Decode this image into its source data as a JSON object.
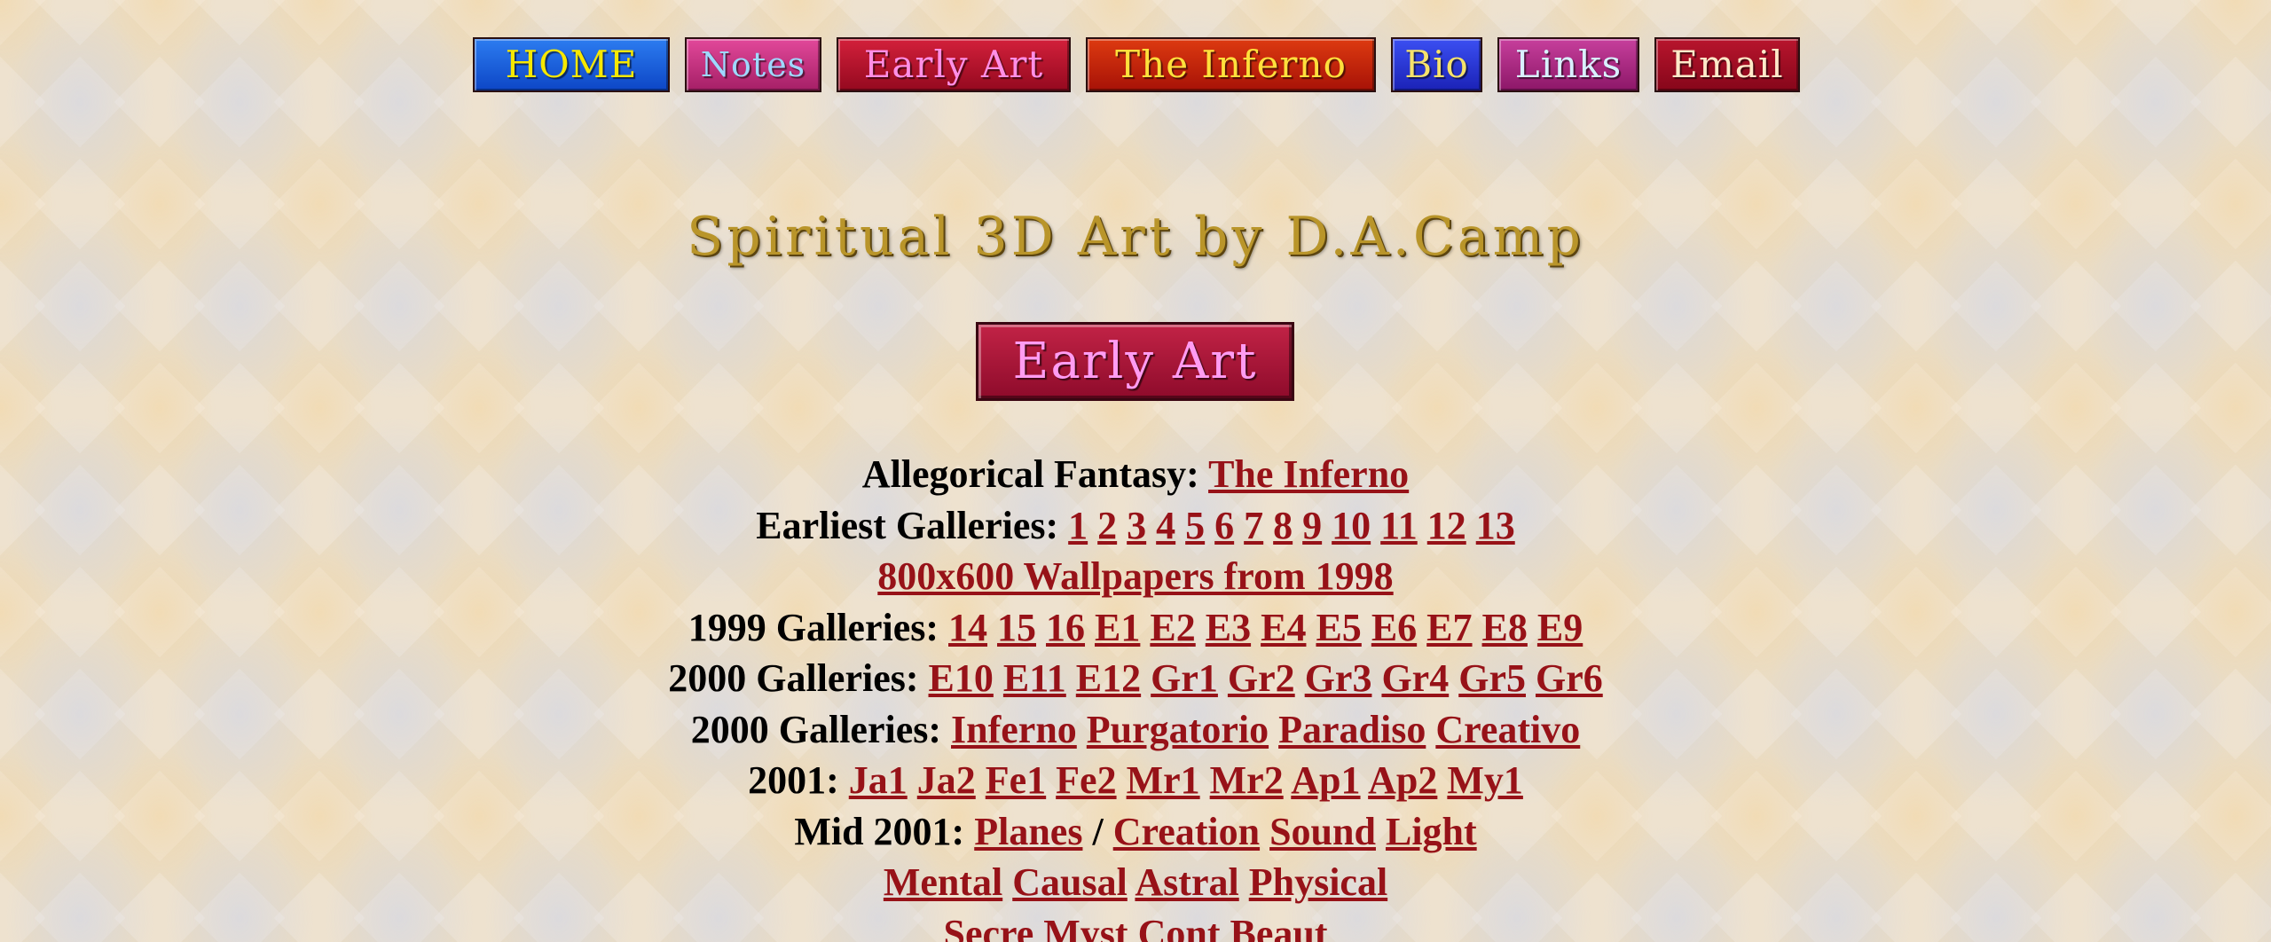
{
  "colors": {
    "link": "#971218",
    "text": "#000000",
    "background": "#eadcc4",
    "title_gold": "#b9952a"
  },
  "nav": {
    "home": "HOME",
    "notes": "Notes",
    "early_art": "Early Art",
    "inferno": "The Inferno",
    "bio": "Bio",
    "links": "Links",
    "email": "Email"
  },
  "title": "Spiritual 3D Art by D.A.Camp",
  "section_badge": "Early Art",
  "gallery": {
    "allegorical": {
      "label": "Allegorical Fantasy:",
      "links": [
        "The Inferno"
      ]
    },
    "earliest": {
      "label": "Earliest Galleries:",
      "links": [
        "1",
        "2",
        "3",
        "4",
        "5",
        "6",
        "7",
        "8",
        "9",
        "10",
        "11",
        "12",
        "13"
      ]
    },
    "wallpapers": {
      "links": [
        "800x600 Wallpapers from 1998"
      ]
    },
    "g1999": {
      "label": "1999 Galleries:",
      "links": [
        "14",
        "15",
        "16",
        "E1",
        "E2",
        "E3",
        "E4",
        "E5",
        "E6",
        "E7",
        "E8",
        "E9"
      ]
    },
    "g2000a": {
      "label": "2000 Galleries:",
      "links": [
        "E10",
        "E11",
        "E12",
        "Gr1",
        "Gr2",
        "Gr3",
        "Gr4",
        "Gr5",
        "Gr6"
      ]
    },
    "g2000b": {
      "label": "2000 Galleries:",
      "links": [
        "Inferno",
        "Purgatorio",
        "Paradiso",
        "Creativo"
      ]
    },
    "g2001": {
      "label": "2001:",
      "links": [
        "Ja1",
        "Ja2",
        "Fe1",
        "Fe2",
        "Mr1",
        "Mr2",
        "Ap1",
        "Ap2",
        "My1"
      ]
    },
    "mid2001": {
      "label": "Mid 2001:",
      "links": [
        "Planes",
        "Creation",
        "Sound",
        "Light"
      ],
      "separator": "/"
    },
    "planes": {
      "links": [
        "Mental",
        "Causal",
        "Astral",
        "Physical"
      ]
    },
    "cut": {
      "links": [
        "Secre",
        "Myst",
        "Cont",
        "Beaut"
      ]
    }
  }
}
